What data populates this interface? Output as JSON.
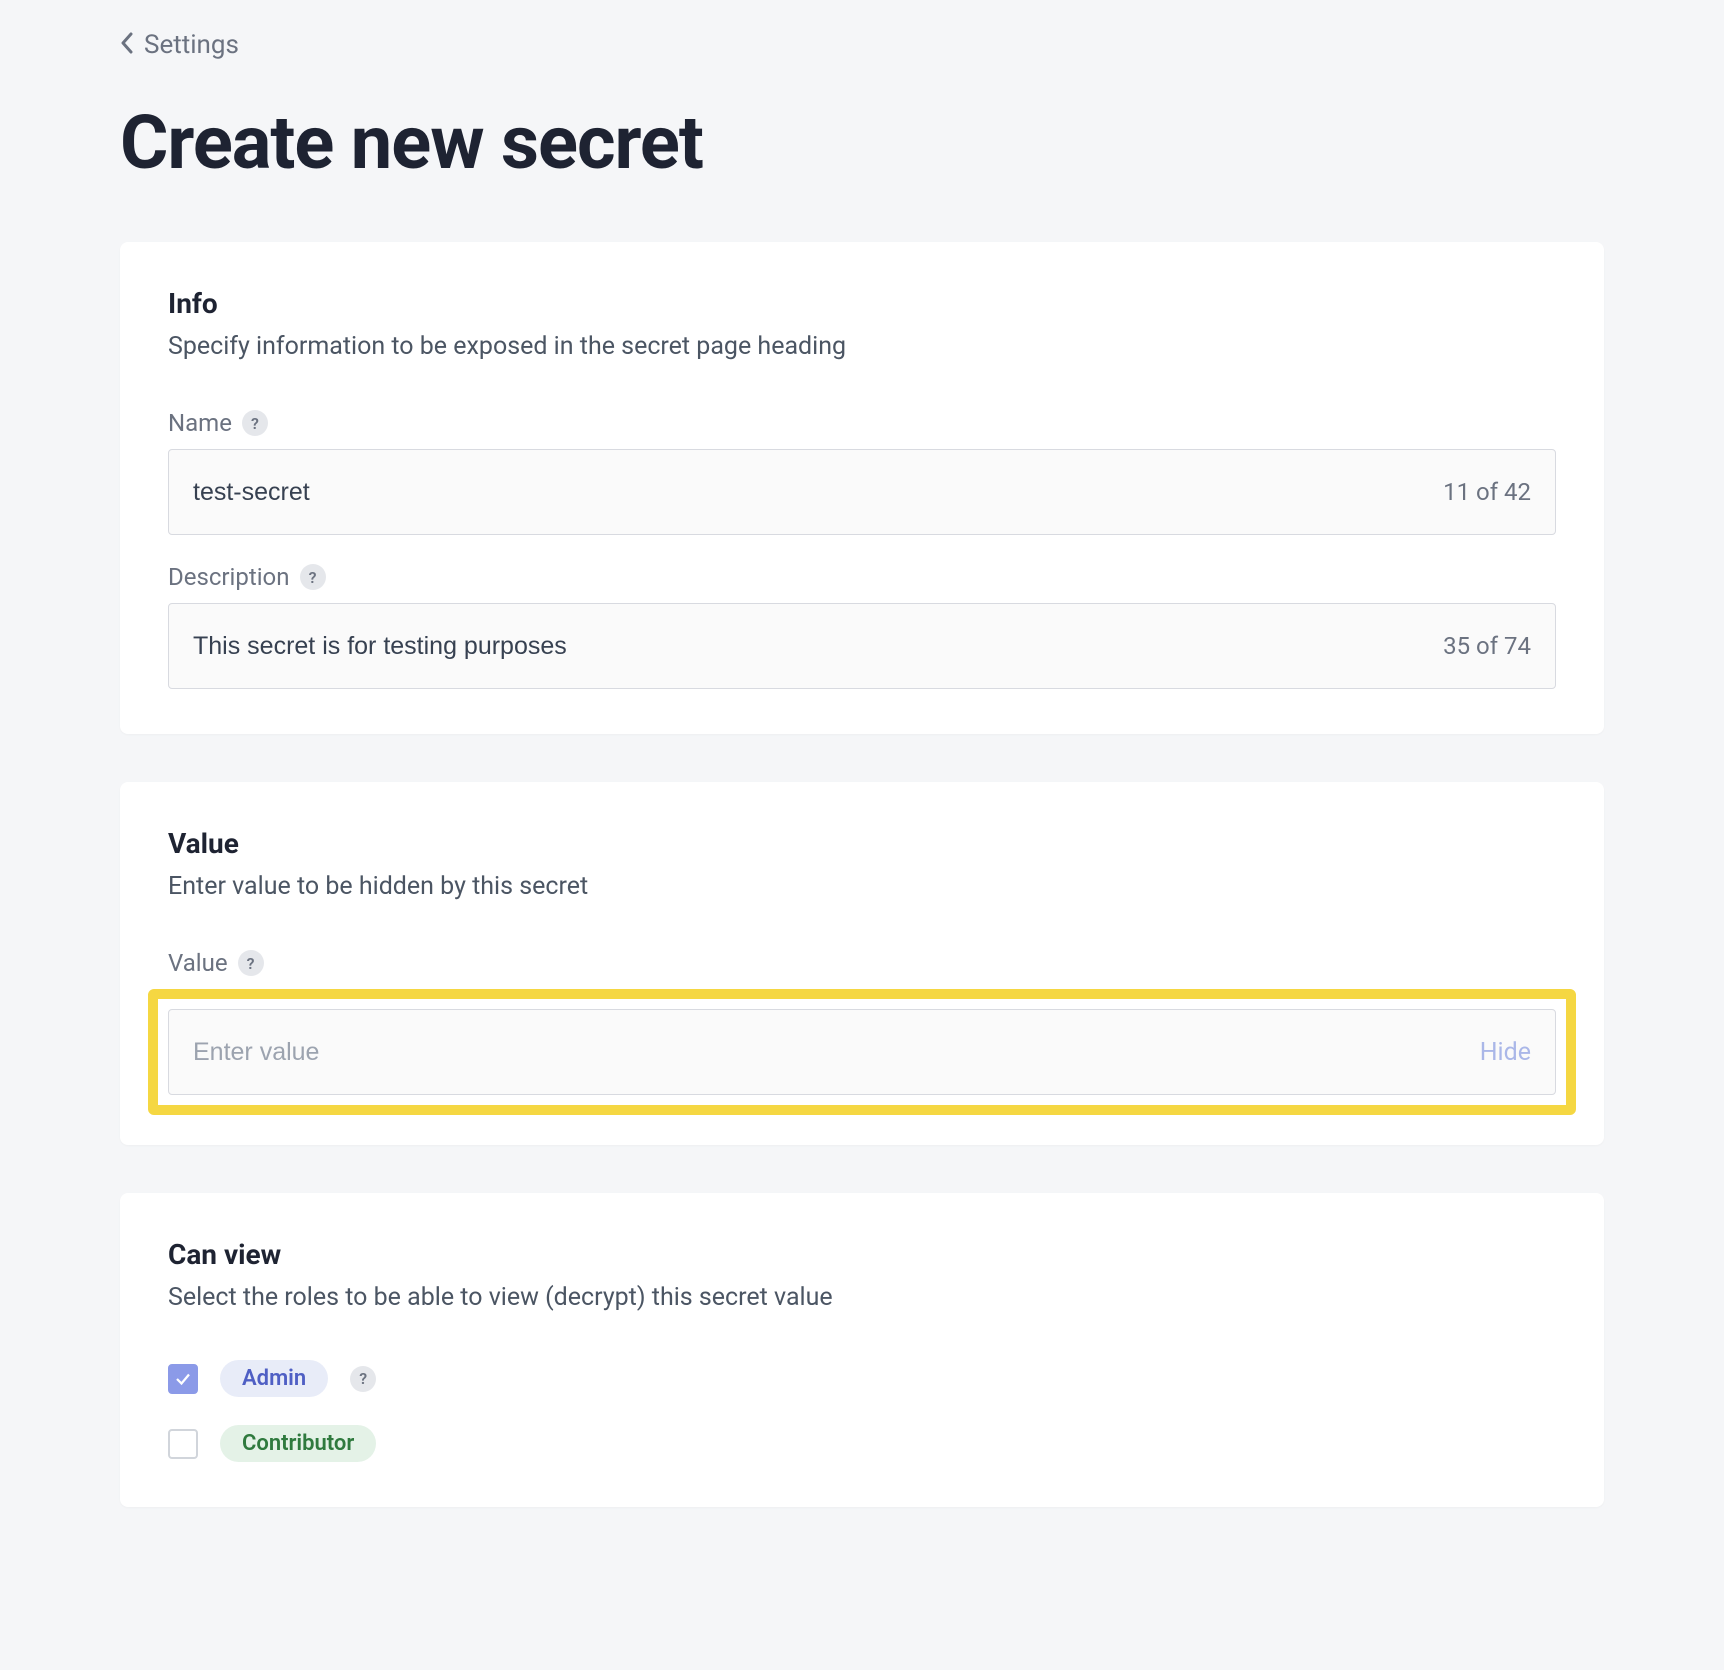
{
  "breadcrumb": {
    "label": "Settings"
  },
  "page": {
    "title": "Create new secret"
  },
  "info": {
    "title": "Info",
    "subtitle": "Specify information to be exposed in the secret page heading",
    "name": {
      "label": "Name",
      "value": "test-secret",
      "count": "11 of 42"
    },
    "description": {
      "label": "Description",
      "value": "This secret is for testing purposes",
      "count": "35 of 74"
    }
  },
  "value": {
    "title": "Value",
    "subtitle": "Enter value to be hidden by this secret",
    "field": {
      "label": "Value",
      "placeholder": "Enter value",
      "hide_label": "Hide"
    }
  },
  "canview": {
    "title": "Can view",
    "subtitle": "Select the roles to be able to view (decrypt) this secret value",
    "roles": [
      {
        "name": "Admin",
        "checked": true,
        "class": "admin",
        "help": true
      },
      {
        "name": "Contributor",
        "checked": false,
        "class": "contributor",
        "help": false
      }
    ]
  },
  "help_glyph": "?"
}
